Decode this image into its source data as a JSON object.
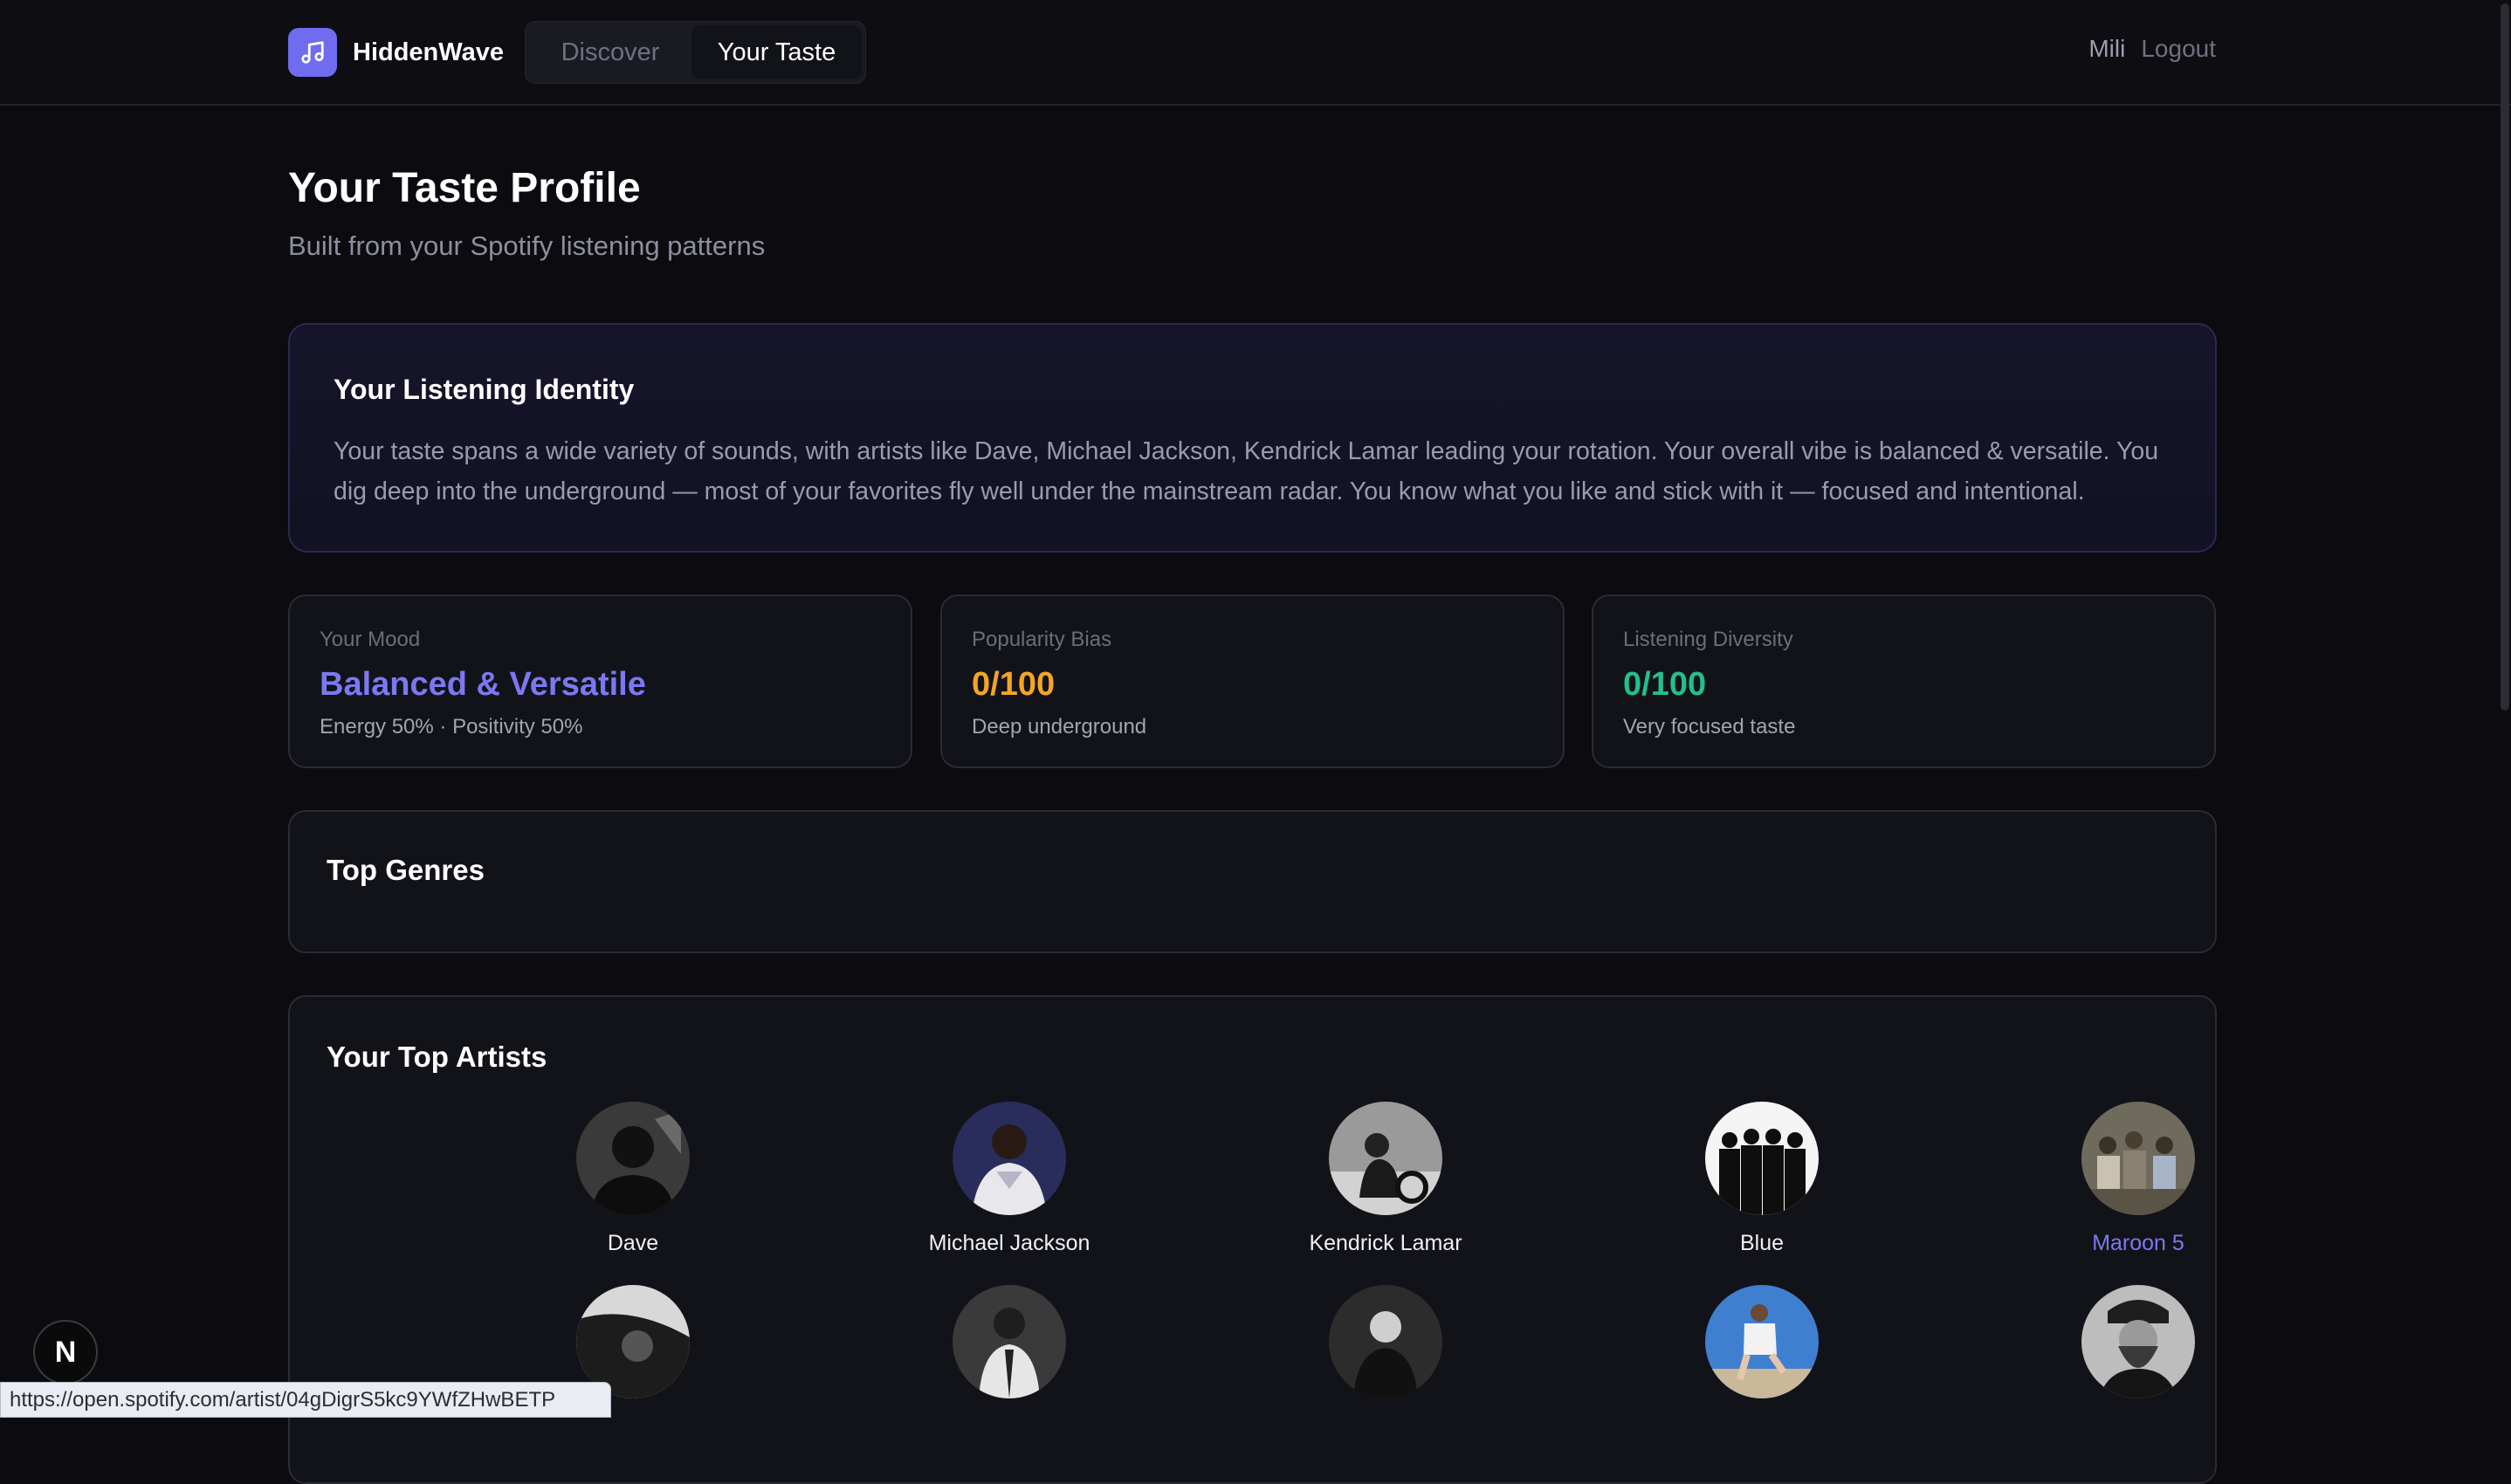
{
  "header": {
    "brand": "HiddenWave",
    "tabs": [
      {
        "label": "Discover",
        "active": false
      },
      {
        "label": "Your Taste",
        "active": true
      }
    ],
    "user": "Mili",
    "logout_label": "Logout"
  },
  "page": {
    "title": "Your Taste Profile",
    "subtitle": "Built from your Spotify listening patterns"
  },
  "identity": {
    "title": "Your Listening Identity",
    "text": "Your taste spans a wide variety of sounds, with artists like Dave, Michael Jackson, Kendrick Lamar leading your rotation. Your overall vibe is balanced & versatile. You dig deep into the underground — most of your favorites fly well under the mainstream radar. You know what you like and stick with it — focused and intentional."
  },
  "stats": [
    {
      "label": "Your Mood",
      "value": "Balanced & Versatile",
      "sub": "Energy 50% · Positivity 50%",
      "color": "#7c78f2"
    },
    {
      "label": "Popularity Bias",
      "value": "0/100",
      "sub": "Deep underground",
      "color": "#f5a524"
    },
    {
      "label": "Listening Diversity",
      "value": "0/100",
      "sub": "Very focused taste",
      "color": "#22c08a"
    }
  ],
  "genres": {
    "title": "Top Genres"
  },
  "artists": {
    "title": "Your Top Artists",
    "row1": [
      "Dave",
      "Michael Jackson",
      "Kendrick Lamar",
      "Blue",
      "Maroon 5"
    ],
    "hovered": "Maroon 5"
  },
  "status_url": "https://open.spotify.com/artist/04gDigrS5kc9YWfZHwBETP",
  "dev_badge": "N",
  "colors": {
    "accent": "#7c78f2",
    "brand": "#6f6cf0",
    "background": "#0b0b10"
  }
}
